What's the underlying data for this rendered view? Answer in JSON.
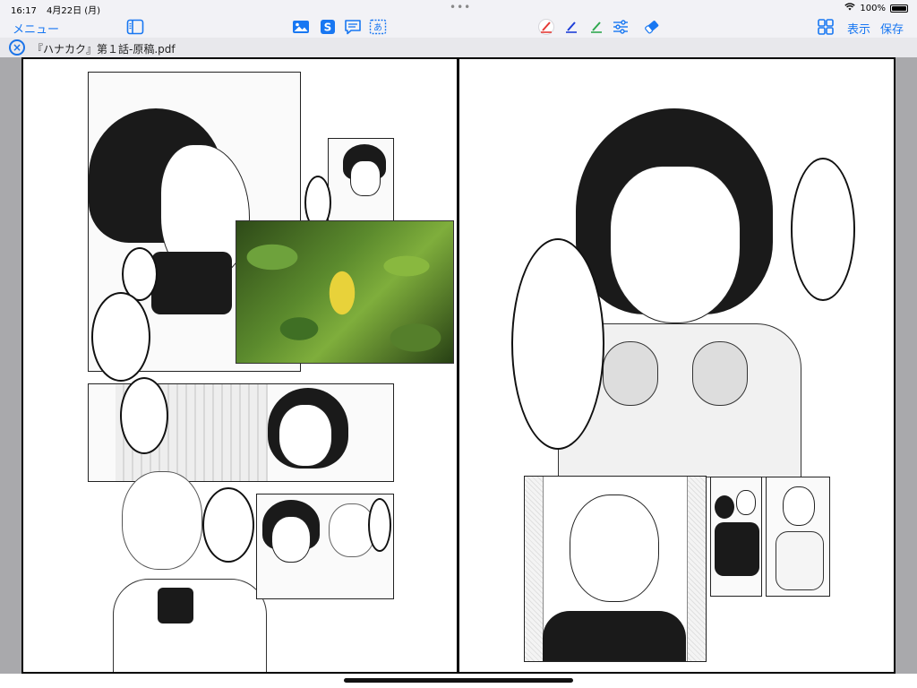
{
  "status": {
    "time": "16:17",
    "date": "4月22日 (月)",
    "battery": "100%"
  },
  "toolbar": {
    "menu_label": "メニュー",
    "view_label": "表示",
    "save_label": "保存",
    "text_button": "S",
    "text_box_icon": "あ",
    "pen_colors": [
      "#e53935",
      "#1e3fd8",
      "#2fa84f"
    ]
  },
  "file": {
    "name": "『ハナカク』第１話-原稿.pdf"
  }
}
